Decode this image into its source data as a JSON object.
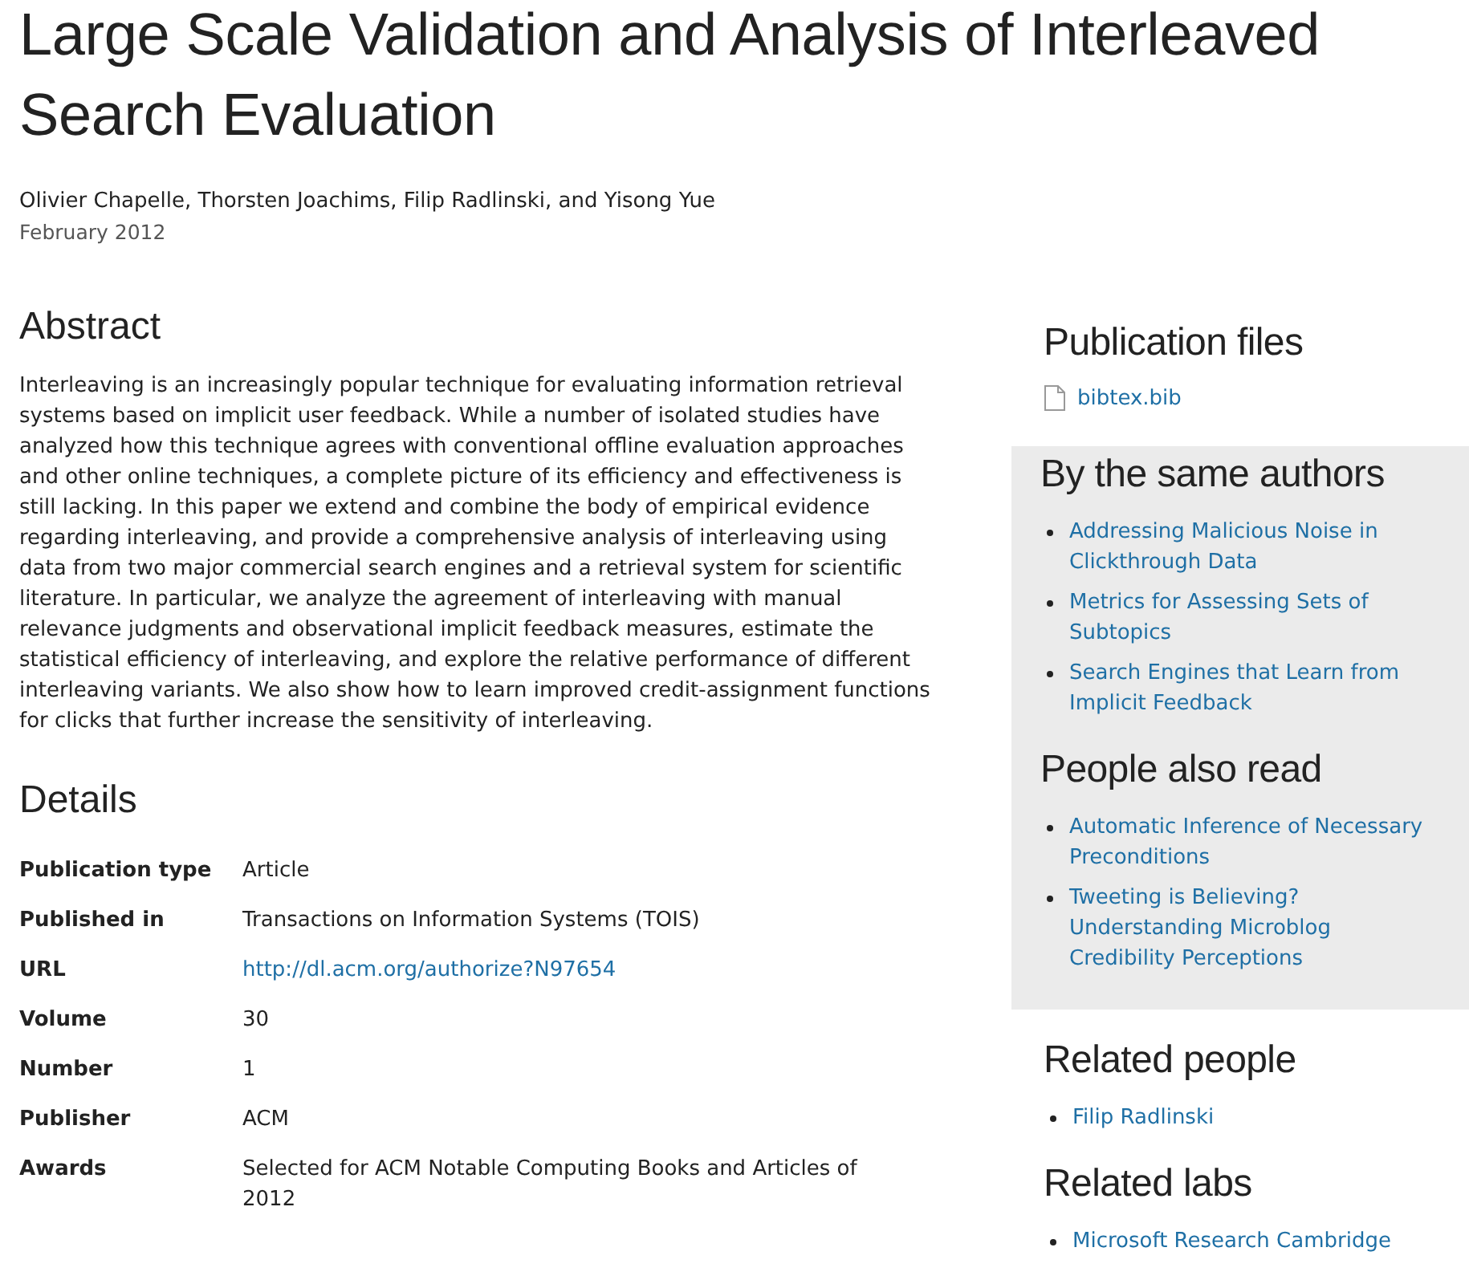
{
  "title": "Large Scale Validation and Analysis of Interleaved Search Evaluation",
  "authors": "Olivier Chapelle, Thorsten Joachims, Filip Radlinski, and Yisong Yue",
  "date": "February 2012",
  "abstract": {
    "heading": "Abstract",
    "text": "Interleaving is an increasingly popular technique for evaluating information retrieval systems based on implicit user feedback. While a number of isolated studies have analyzed how this technique agrees with conventional offline evaluation approaches and other online techniques, a complete picture of its efficiency and effectiveness is still lacking. In this paper we extend and combine the body of empirical evidence regarding interleaving, and provide a comprehensive analysis of interleaving using data from two major commercial search engines and a retrieval system for scientific literature. In particular, we analyze the agreement of interleaving with manual relevance judgments and observational implicit feedback measures, estimate the statistical efficiency of interleaving, and explore the relative performance of different interleaving variants. We also show how to learn improved credit-assignment functions for clicks that further increase the sensitivity of interleaving."
  },
  "details": {
    "heading": "Details",
    "rows": [
      {
        "label": "Publication type",
        "value": "Article",
        "kind": "text"
      },
      {
        "label": "Published in",
        "value": "Transactions on Information Systems (TOIS)",
        "kind": "text"
      },
      {
        "label": "URL",
        "value": "http://dl.acm.org/authorize?N97654",
        "kind": "link"
      },
      {
        "label": "Volume",
        "value": "30",
        "kind": "text"
      },
      {
        "label": "Number",
        "value": "1",
        "kind": "text"
      },
      {
        "label": "Publisher",
        "value": "ACM",
        "kind": "text"
      },
      {
        "label": "Awards",
        "value": "Selected for ACM Notable Computing Books and Articles of 2012",
        "kind": "text"
      }
    ]
  },
  "sidebar": [
    {
      "heading": "Publication files",
      "shaded": false,
      "kind": "files",
      "items": [
        "bibtex.bib"
      ]
    },
    {
      "heading": "By the same authors",
      "shaded": true,
      "kind": "list",
      "items": [
        "Addressing Malicious Noise in Clickthrough Data",
        "Metrics for Assessing Sets of Subtopics",
        "Search Engines that Learn from Implicit Feedback"
      ]
    },
    {
      "heading": "People also read",
      "shaded": true,
      "kind": "list",
      "items": [
        "Automatic Inference of Necessary Preconditions",
        "Tweeting is Believing? Understanding Microblog Credibility Perceptions"
      ]
    },
    {
      "heading": "Related people",
      "shaded": false,
      "kind": "list",
      "items": [
        "Filip Radlinski"
      ]
    },
    {
      "heading": "Related labs",
      "shaded": false,
      "kind": "list",
      "items": [
        "Microsoft Research Cambridge"
      ]
    }
  ]
}
